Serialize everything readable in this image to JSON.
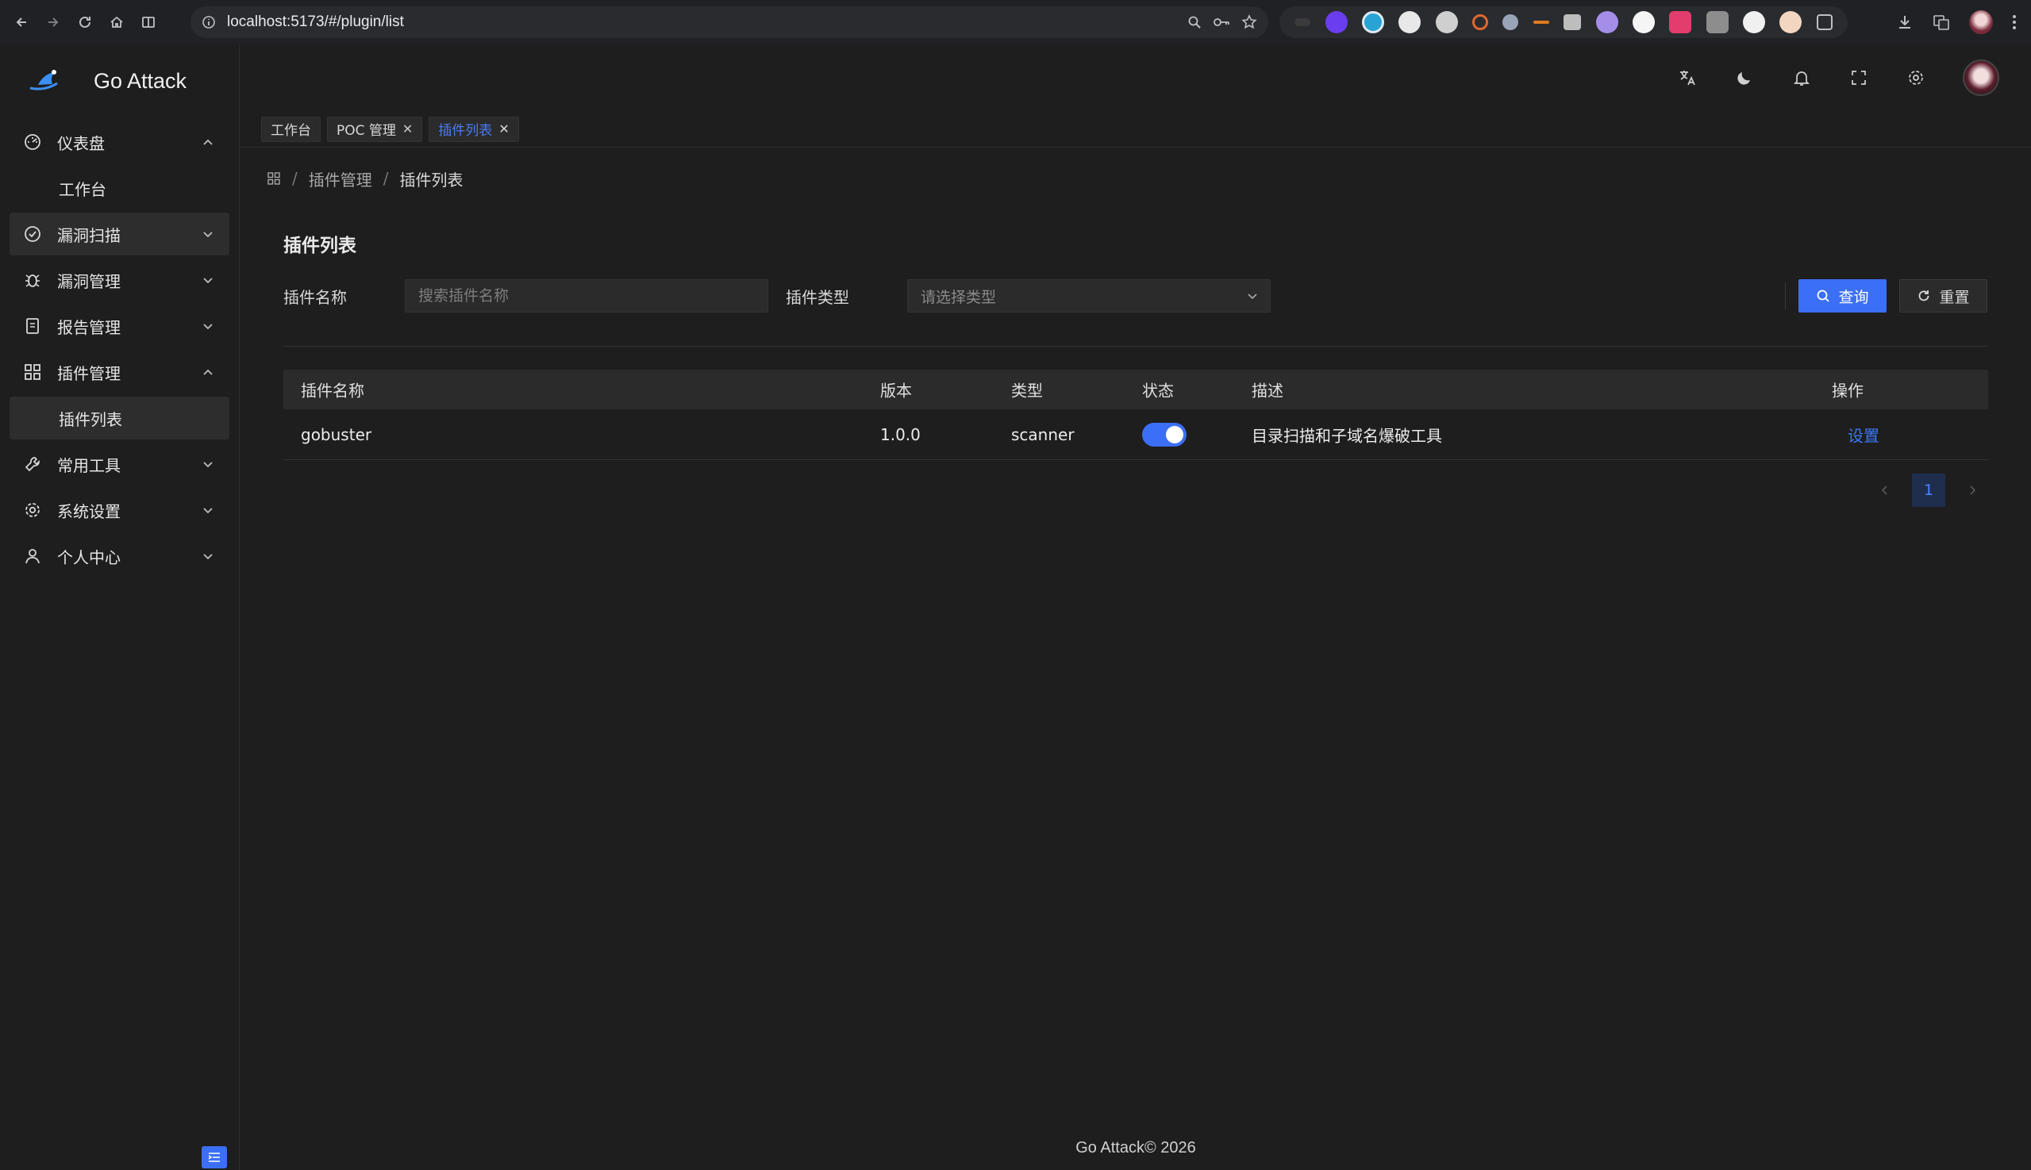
{
  "browser": {
    "url": "localhost:5173/#/plugin/list"
  },
  "app": {
    "title": "Go Attack",
    "footer": "Go Attack© 2026"
  },
  "sidebar": {
    "items": [
      {
        "label": "仪表盘",
        "icon": "dashboard-icon",
        "expanded": true
      },
      {
        "label": "工作台",
        "sub": true
      },
      {
        "label": "漏洞扫描",
        "icon": "scan-icon",
        "expanded": false
      },
      {
        "label": "漏洞管理",
        "icon": "bug-icon",
        "expanded": false
      },
      {
        "label": "报告管理",
        "icon": "report-icon",
        "expanded": false
      },
      {
        "label": "插件管理",
        "icon": "plugin-grid-icon",
        "expanded": true
      },
      {
        "label": "插件列表",
        "sub": true,
        "active": true
      },
      {
        "label": "常用工具",
        "icon": "wrench-icon",
        "expanded": false
      },
      {
        "label": "系统设置",
        "icon": "settings-icon",
        "expanded": false
      },
      {
        "label": "个人中心",
        "icon": "user-icon",
        "expanded": false
      }
    ]
  },
  "tabs": [
    {
      "label": "工作台",
      "closable": false
    },
    {
      "label": "POC 管理",
      "closable": true
    },
    {
      "label": "插件列表",
      "closable": true,
      "active": true
    }
  ],
  "breadcrumb": {
    "level1": "插件管理",
    "level2": "插件列表"
  },
  "page": {
    "title": "插件列表"
  },
  "filters": {
    "name_label": "插件名称",
    "name_placeholder": "搜索插件名称",
    "type_label": "插件类型",
    "type_placeholder": "请选择类型",
    "query_button": "查询",
    "reset_button": "重置"
  },
  "table": {
    "columns": [
      "插件名称",
      "版本",
      "类型",
      "状态",
      "描述",
      "操作"
    ],
    "rows": [
      {
        "name": "gobuster",
        "version": "1.0.0",
        "type": "scanner",
        "enabled": true,
        "description": "目录扫描和子域名爆破工具",
        "action": "设置"
      }
    ]
  },
  "pagination": {
    "current_page": "1"
  },
  "colors": {
    "accent": "#3b6ff5",
    "background": "#1e1e1e",
    "panel": "#2b2b2b"
  }
}
